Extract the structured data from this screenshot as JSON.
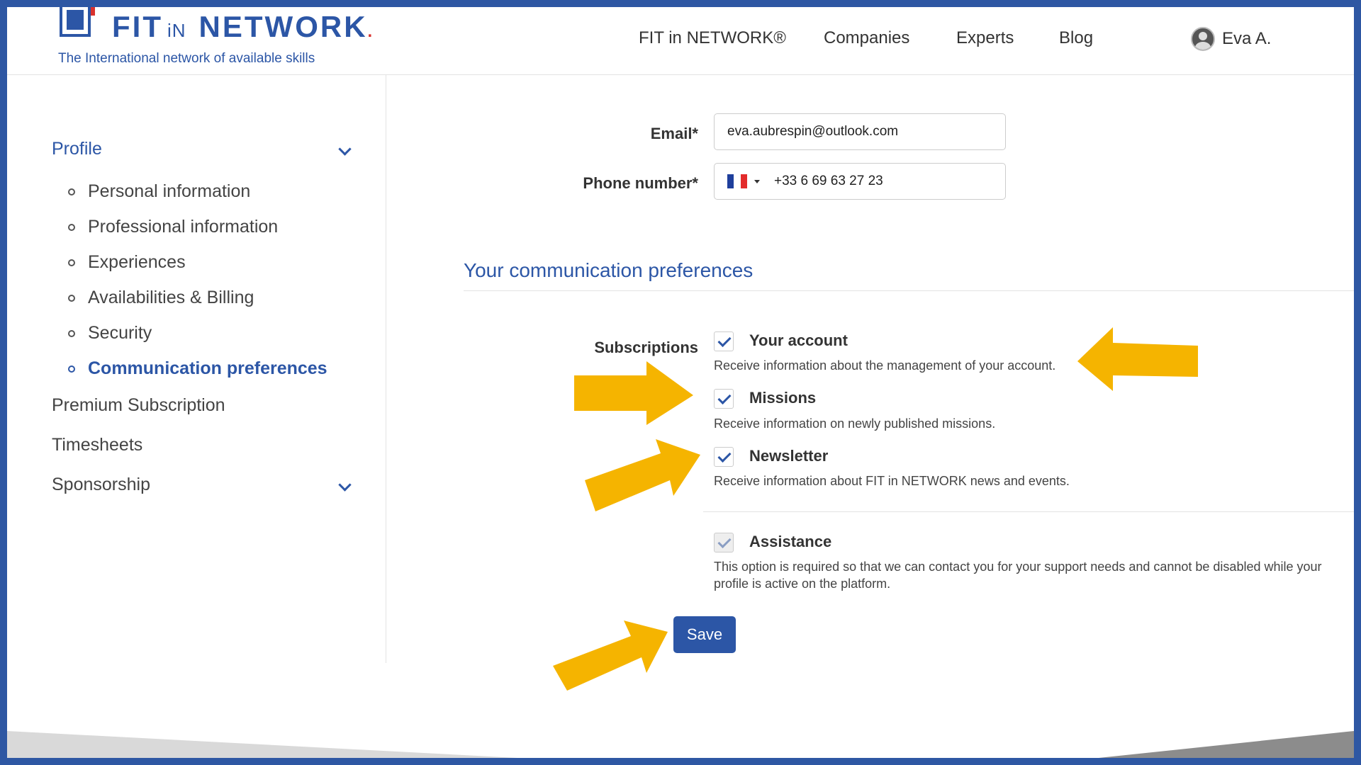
{
  "brand": {
    "name_fit": "FIT",
    "name_in": "iN",
    "name_network": "NETWORK",
    "tagline": "The International network of available skills",
    "blue": "#2c56a6",
    "red": "#d9322e"
  },
  "nav": {
    "items": [
      "FIT in NETWORK®",
      "Companies",
      "Experts",
      "Blog"
    ],
    "user_name": "Eva A."
  },
  "sidebar": {
    "profile_label": "Profile",
    "profile_items": [
      "Personal information",
      "Professional information",
      "Experiences",
      "Availabilities & Billing",
      "Security",
      "Communication preferences"
    ],
    "active_item": "Communication preferences",
    "premium_label": "Premium Subscription",
    "timesheets_label": "Timesheets",
    "sponsorship_label": "Sponsorship"
  },
  "form": {
    "email_label": "Email*",
    "email_value": "eva.aubrespin@outlook.com",
    "phone_label": "Phone number*",
    "phone_value": "+33 6 69 63 27 23",
    "phone_country_icon": "france-flag-icon"
  },
  "preferences": {
    "title": "Your communication preferences",
    "subscriptions_label": "Subscriptions",
    "items": [
      {
        "title": "Your account",
        "desc": "Receive information about the management of your account.",
        "checked": true,
        "disabled": false
      },
      {
        "title": "Missions",
        "desc": "Receive information on newly published missions.",
        "checked": true,
        "disabled": false
      },
      {
        "title": "Newsletter",
        "desc": "Receive information about FIT in NETWORK news and events.",
        "checked": true,
        "disabled": false
      },
      {
        "title": "Assistance",
        "desc": "This option is required so that we can contact you for your support needs and cannot be disabled while your profile is active on the platform.",
        "checked": true,
        "disabled": true
      }
    ],
    "save_label": "Save"
  },
  "annotation_color": "#f5b400",
  "frame_color": "#2e57a3"
}
